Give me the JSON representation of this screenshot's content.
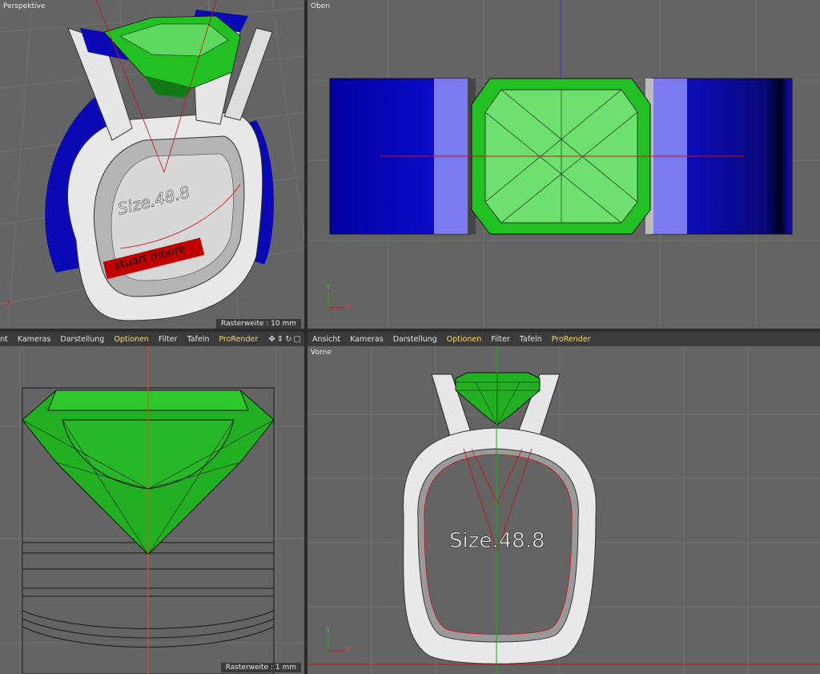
{
  "viewports": {
    "perspective": {
      "label": "Perspektive",
      "raster": "Rasterweite : 10 mm",
      "size_text": "Size.48.8",
      "engraving": "stuart moore"
    },
    "top": {
      "label": "Oben"
    },
    "right": {
      "raster": "Rasterweite : 1 mm"
    },
    "front": {
      "label": "Vorne",
      "size_text": "Size.48.8"
    }
  },
  "menubar_left": {
    "items": [
      "nt",
      "Kameras",
      "Darstellung",
      "Optionen",
      "Filter",
      "Tafeln",
      "ProRender"
    ],
    "nav_icons": [
      "move-icon",
      "zoom-icon",
      "rotate-icon",
      "maximize-icon"
    ]
  },
  "menubar_right": {
    "items": [
      "Ansicht",
      "Kameras",
      "Darstellung",
      "Optionen",
      "Filter",
      "Tafeln",
      "ProRender"
    ]
  },
  "colors": {
    "viewport_bg": "#646464",
    "grid": "#707070",
    "gem_green": "#22c022",
    "gem_light": "#7ee07e",
    "band_blue": "#0a0ab4",
    "setting_white": "#e6e6e6",
    "engraving_red": "#c00000",
    "highlight": "#ffd95a"
  },
  "axes": {
    "x": "X",
    "y": "Y",
    "z": "Z"
  }
}
